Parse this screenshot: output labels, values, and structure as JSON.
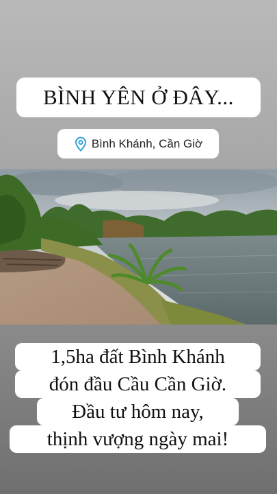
{
  "story": {
    "title": "BÌNH YÊN Ở ĐÂY...",
    "location": {
      "icon": "location-pin-icon",
      "label": "Bình Khánh, Cần Giờ",
      "icon_color": "#2f9ed9"
    },
    "photo": {
      "description_icon": "riverside-land-photo"
    },
    "caption_lines": [
      "1,5ha đất Bình Khánh",
      "đón đầu Cầu Cần Giờ.",
      "Đầu tư hôm nay,",
      "thịnh vượng ngày mai!"
    ]
  }
}
